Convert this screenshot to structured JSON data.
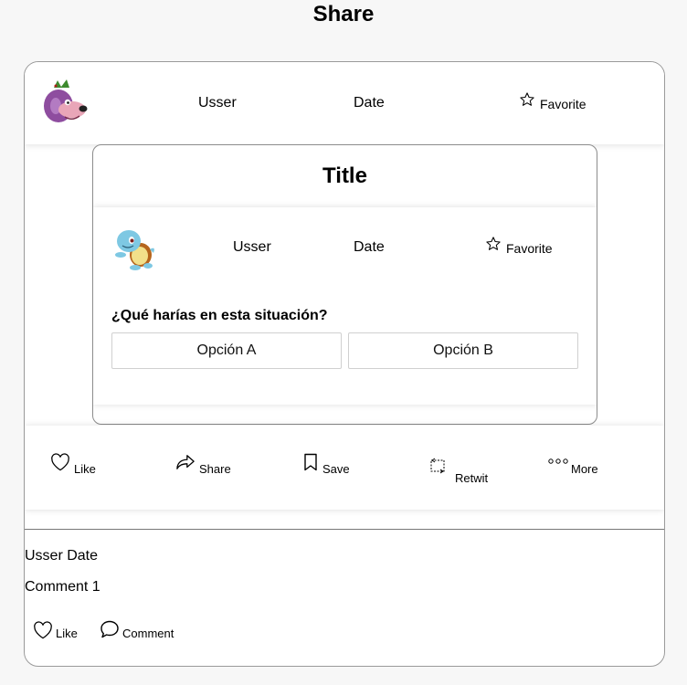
{
  "page": {
    "title": "Share"
  },
  "post": {
    "user": "Usser",
    "date": "Date",
    "favorite_label": "Favorite",
    "avatar_icon": "purple-dog-avatar-icon"
  },
  "shared_card": {
    "title": "Title",
    "user": "Usser",
    "date": "Date",
    "favorite_label": "Favorite",
    "avatar_icon": "turtle-avatar-icon",
    "question": "¿Qué harías en esta situación?",
    "options": [
      "Opción A",
      "Opción B"
    ]
  },
  "actions": {
    "like": "Like",
    "share": "Share",
    "save": "Save",
    "retwit": "Retwit",
    "more": "More"
  },
  "comment": {
    "meta": "Usser Date",
    "text": "Comment 1",
    "like": "Like",
    "comment": "Comment"
  }
}
